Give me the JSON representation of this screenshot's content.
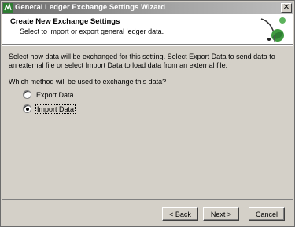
{
  "window": {
    "title": "General Ledger Exchange Settings Wizard",
    "close_glyph": "✕"
  },
  "header": {
    "title": "Create New Exchange Settings",
    "subtitle": "Select to import or export general ledger data."
  },
  "body": {
    "description": "Select how data will be exchanged for this setting.  Select Export Data to send data to an external file or select Import Data to load data from an external file.",
    "question": "Which method will be used to exchange this data?",
    "options": [
      {
        "label": "Export Data",
        "selected": false
      },
      {
        "label": "Import Data",
        "selected": true
      }
    ]
  },
  "buttons": {
    "back": "< Back",
    "next": "Next >",
    "cancel": "Cancel"
  },
  "colors": {
    "title_bar": "#8a8a8a",
    "dialog_bg": "#d4d0c8",
    "header_bg": "#ffffff",
    "logo_green": "#3f9a3f"
  },
  "icons": {
    "app": "ledger-wizard-icon",
    "logo": "wizard-logo-icon",
    "close": "close-icon"
  }
}
